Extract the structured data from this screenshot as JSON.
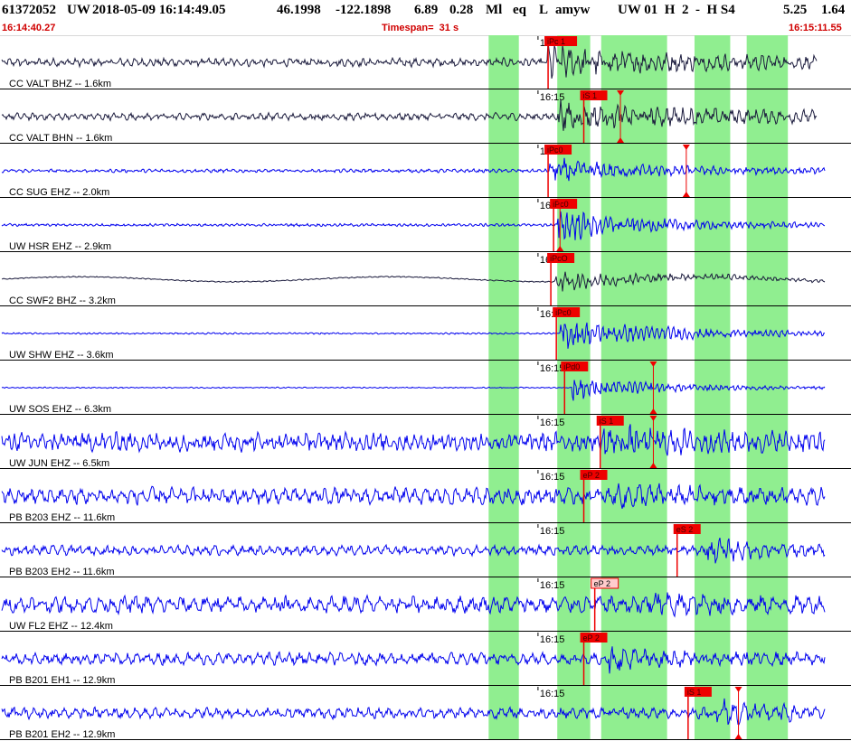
{
  "header": {
    "event_id": "61372052",
    "network": "UW",
    "datetime": "2018-05-09 16:14:49.05",
    "lat": "46.1998",
    "lon": "-122.1898",
    "depth": "6.89",
    "mag": "0.28",
    "mag_type": "Ml",
    "etype": "eq",
    "flag": "L",
    "analyst": "amyw",
    "sta_info": "UW 01  H  2  -  H S4",
    "v1": "5.25",
    "v2": "1.64"
  },
  "subheader": {
    "start_time": "16:14:40.27",
    "timespan": "Timespan=  31 s",
    "end_time": "16:15:11.55"
  },
  "colors": {
    "blue": "#0000ee",
    "dark": "#1a1a3c",
    "pick": "#ee0000",
    "green": "#90ee90"
  },
  "chart_data": {
    "type": "waveform",
    "timespan_s": 31,
    "time_range": [
      "16:14:40.27",
      "16:15:11.55"
    ],
    "time_tick_label": "16:15",
    "green_bands_s": [
      [
        17.8,
        18.9
      ],
      [
        20.3,
        21.5
      ],
      [
        21.9,
        23.2
      ],
      [
        22.9,
        24.3
      ],
      [
        25.3,
        26.6
      ],
      [
        27.2,
        28.7
      ]
    ],
    "traces": [
      {
        "label": "CC VALT BHZ -- 1.6km",
        "color": "dark",
        "picks": [
          {
            "label": "iPc 1",
            "t": 19.9,
            "style": "solid"
          }
        ],
        "onset": 19.9,
        "tri": null,
        "noise": 0.35,
        "burst": 1.0,
        "decay": 6,
        "freq": 2.2,
        "drift": 0
      },
      {
        "label": "CC VALT BHN -- 1.6km",
        "color": "dark",
        "picks": [
          {
            "label": "iS 1",
            "t": 21.2,
            "style": "solid"
          }
        ],
        "onset": 20.3,
        "tri": 22.6,
        "noise": 0.3,
        "burst": 0.9,
        "decay": 7,
        "freq": 2.0,
        "drift": 0
      },
      {
        "label": "CC SUG EHZ -- 2.0km",
        "color": "blue",
        "picks": [
          {
            "label": "iPc0",
            "t": 19.9,
            "style": "solid"
          }
        ],
        "onset": 20.0,
        "tri": 25.0,
        "noise": 0.15,
        "burst": 0.8,
        "decay": 5,
        "freq": 2.5,
        "drift": 0
      },
      {
        "label": "UW HSR EHZ -- 2.9km",
        "color": "blue",
        "picks": [
          {
            "label": "iPc0",
            "t": 20.1,
            "style": "solid"
          }
        ],
        "onset": 20.3,
        "tri": 20.4,
        "noise": 0.12,
        "burst": 1.1,
        "decay": 4,
        "freq": 3.0,
        "drift": 0
      },
      {
        "label": "CC SWF2 BHZ -- 3.2km",
        "color": "dark",
        "picks": [
          {
            "label": "iPcO",
            "t": 20.0,
            "style": "solid"
          }
        ],
        "onset": 20.2,
        "tri": null,
        "noise": 0.05,
        "burst": 0.7,
        "decay": 5,
        "freq": 2.8,
        "drift": 0.25
      },
      {
        "label": "UW SHW EHZ -- 3.6km",
        "color": "blue",
        "picks": [
          {
            "label": "iPc0",
            "t": 20.2,
            "style": "solid"
          }
        ],
        "onset": 20.4,
        "tri": null,
        "noise": 0.07,
        "burst": 1.0,
        "decay": 5,
        "freq": 3.0,
        "drift": 0
      },
      {
        "label": "UW SOS EHZ -- 6.3km",
        "color": "blue",
        "picks": [
          {
            "label": "iPd0",
            "t": 20.5,
            "style": "solid"
          }
        ],
        "onset": 20.8,
        "tri": 23.8,
        "noise": 0.05,
        "burst": 0.8,
        "decay": 4,
        "freq": 3.0,
        "drift": 0
      },
      {
        "label": "UW JUN EHZ -- 6.5km",
        "color": "blue",
        "picks": [
          {
            "label": "iS 1",
            "t": 21.8,
            "style": "solid"
          }
        ],
        "onset": 22.0,
        "tri": 23.8,
        "noise": 0.8,
        "burst": 0.6,
        "decay": 4,
        "freq": 2.4,
        "drift": 0
      },
      {
        "label": "PB B203 EHZ -- 11.6km",
        "color": "blue",
        "picks": [
          {
            "label": "eP 2",
            "t": 21.2,
            "style": "solid"
          }
        ],
        "onset": 22.5,
        "tri": null,
        "noise": 0.7,
        "burst": 0.4,
        "decay": 3,
        "freq": 1.6,
        "drift": 0
      },
      {
        "label": "PB B203 EH2 -- 11.6km",
        "color": "blue",
        "picks": [
          {
            "label": "eS 2",
            "t": 24.6,
            "style": "solid"
          }
        ],
        "onset": 25.7,
        "tri": null,
        "noise": 0.4,
        "burst": 0.6,
        "decay": 3,
        "freq": 1.8,
        "drift": 0
      },
      {
        "label": "UW FL2 EHZ -- 12.4km",
        "color": "blue",
        "picks": [
          {
            "label": "eP 2",
            "t": 21.6,
            "style": "dashed"
          }
        ],
        "onset": 23.2,
        "tri": null,
        "noise": 0.7,
        "burst": 0.5,
        "decay": 3,
        "freq": 1.4,
        "drift": 0
      },
      {
        "label": "PB B201 EH1 -- 12.9km",
        "color": "blue",
        "picks": [
          {
            "label": "eP 2",
            "t": 21.2,
            "style": "solid"
          }
        ],
        "onset": 22.2,
        "tri": null,
        "noise": 0.5,
        "burst": 0.5,
        "decay": 3,
        "freq": 1.6,
        "drift": 0
      },
      {
        "label": "PB B201 EH2 -- 12.9km",
        "color": "blue",
        "picks": [
          {
            "label": "iS 1",
            "t": 25.0,
            "style": "solid"
          }
        ],
        "onset": 26.1,
        "tri": 26.9,
        "noise": 0.45,
        "burst": 0.6,
        "decay": 3,
        "freq": 1.6,
        "drift": 0
      }
    ]
  }
}
